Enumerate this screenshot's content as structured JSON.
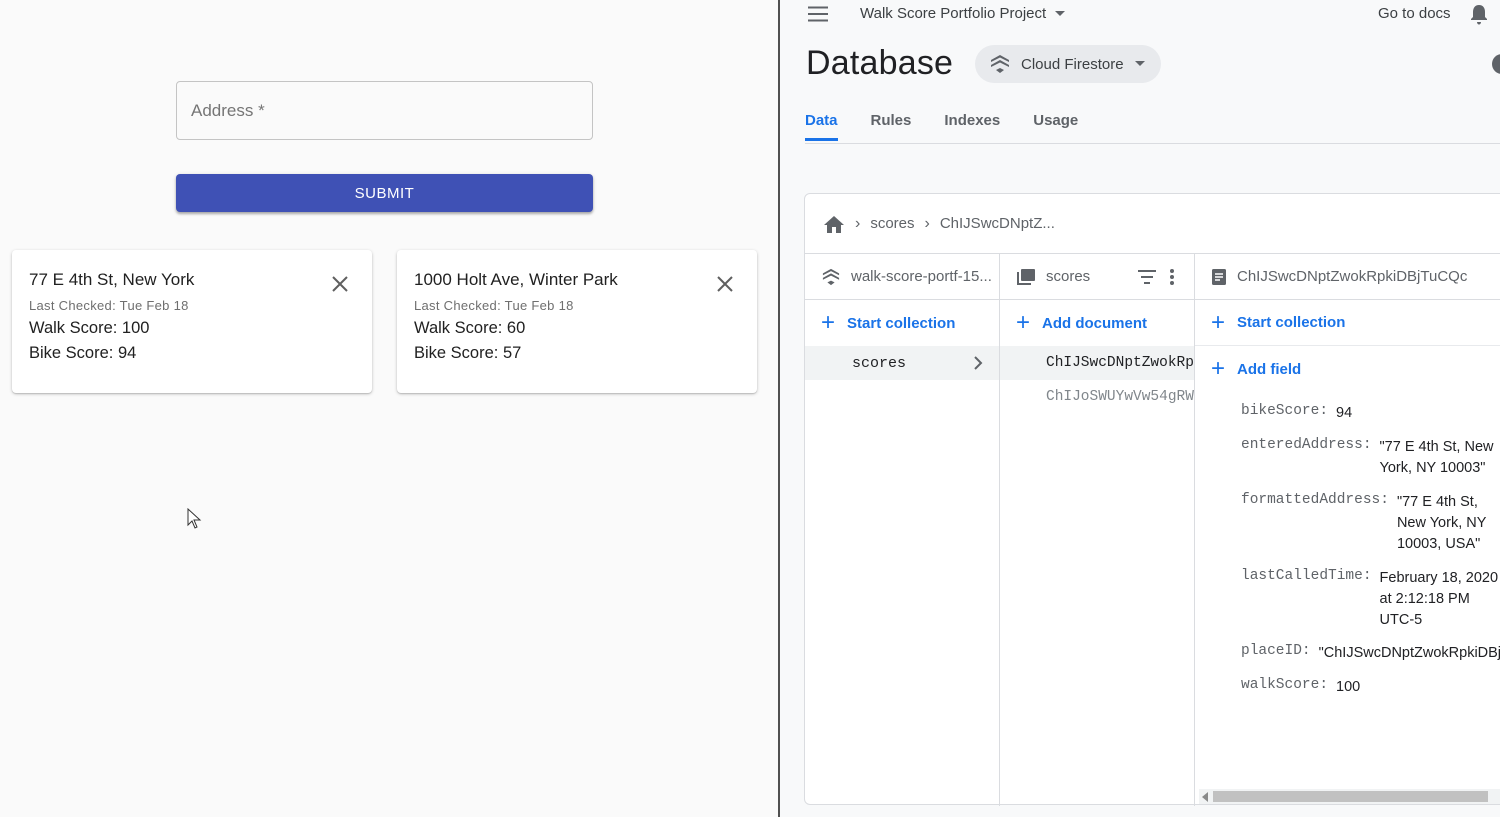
{
  "left": {
    "address": {
      "placeholder": "Address *",
      "value": ""
    },
    "submit_label": "SUBMIT",
    "cards": [
      {
        "title": "77 E 4th St, New York",
        "last_checked": "Last Checked: Tue Feb 18",
        "walk": "Walk Score: 100",
        "bike": "Bike Score: 94"
      },
      {
        "title": "1000 Holt Ave, Winter Park",
        "last_checked": "Last Checked: Tue Feb 18",
        "walk": "Walk Score: 60",
        "bike": "Bike Score: 57"
      }
    ]
  },
  "header": {
    "project": "Walk Score Portfolio Project",
    "docs": "Go to docs",
    "title": "Database",
    "product": "Cloud Firestore"
  },
  "tabs": [
    "Data",
    "Rules",
    "Indexes",
    "Usage"
  ],
  "breadcrumb": {
    "collection": "scores",
    "document": "ChIJSwcDNptZ..."
  },
  "columns": {
    "root": {
      "name": "walk-score-portf-15...",
      "action": "Start collection",
      "items": [
        "scores"
      ]
    },
    "collection": {
      "name": "scores",
      "action": "Add document",
      "items": [
        "ChIJSwcDNptZwokRp",
        "ChIJoSWUYwVw54gRW"
      ]
    },
    "document": {
      "name": "ChIJSwcDNptZwokRpkiDBjTuCQc",
      "action_collection": "Start collection",
      "action_field": "Add field",
      "fields": [
        {
          "key": "bikeScore:",
          "value": "94"
        },
        {
          "key": "enteredAddress:",
          "value": "\"77 E 4th St, New York, NY 10003\""
        },
        {
          "key": "formattedAddress:",
          "value": "\"77 E 4th St, New York, NY 10003, USA\""
        },
        {
          "key": "lastCalledTime:",
          "value": "February 18, 2020 at 2:12:18 PM UTC-5"
        },
        {
          "key": "placeID:",
          "value": "\"ChIJSwcDNptZwokRpkiDBj"
        },
        {
          "key": "walkScore:",
          "value": "100"
        }
      ]
    }
  },
  "colors": {
    "primary": "#3f51b5",
    "accent": "#1a73e8"
  }
}
